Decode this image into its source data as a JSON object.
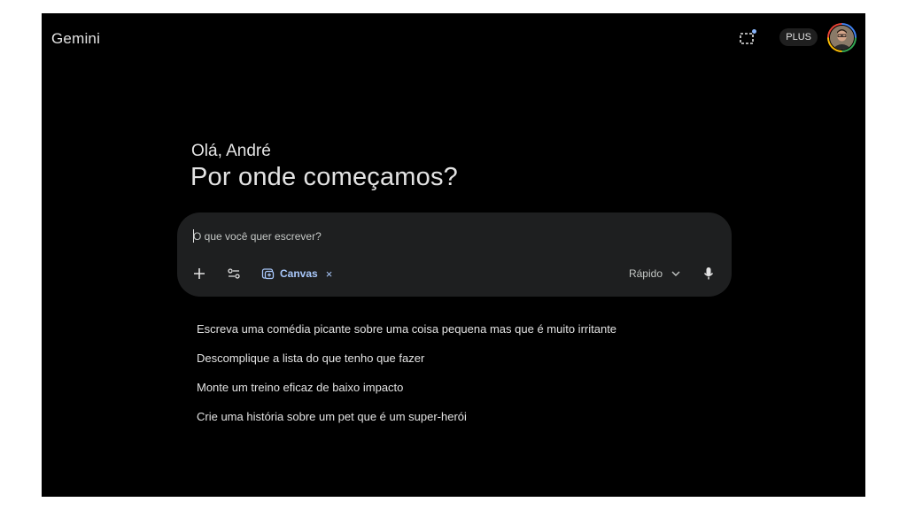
{
  "app": {
    "name": "Gemini"
  },
  "header": {
    "plan_badge": "PLUS",
    "screen_icon": "screen-select-icon",
    "avatar_icon": "user-avatar"
  },
  "greeting": {
    "hello": "Olá, André",
    "headline": "Por onde começamos?"
  },
  "composer": {
    "placeholder": "O que você quer escrever?",
    "add_icon": "plus-icon",
    "tools_icon": "tools-icon",
    "canvas_label": "Canvas",
    "canvas_icon": "canvas-icon",
    "canvas_close": "×",
    "model_label": "Rápido",
    "model_chevron": "⌄",
    "mic_icon": "mic-icon"
  },
  "suggestions": [
    "Escreva uma comédia picante sobre uma coisa pequena mas que é muito irritante",
    "Descomplique a lista do que tenho que fazer",
    "Monte um treino eficaz de baixo impacto",
    "Crie uma história sobre um pet que é um super-herói"
  ],
  "colors": {
    "background": "#000000",
    "composer": "#1e1f20",
    "text": "#e3e3e3",
    "accent": "#a8c7fa",
    "notification_dot": "#8ab4f8"
  }
}
